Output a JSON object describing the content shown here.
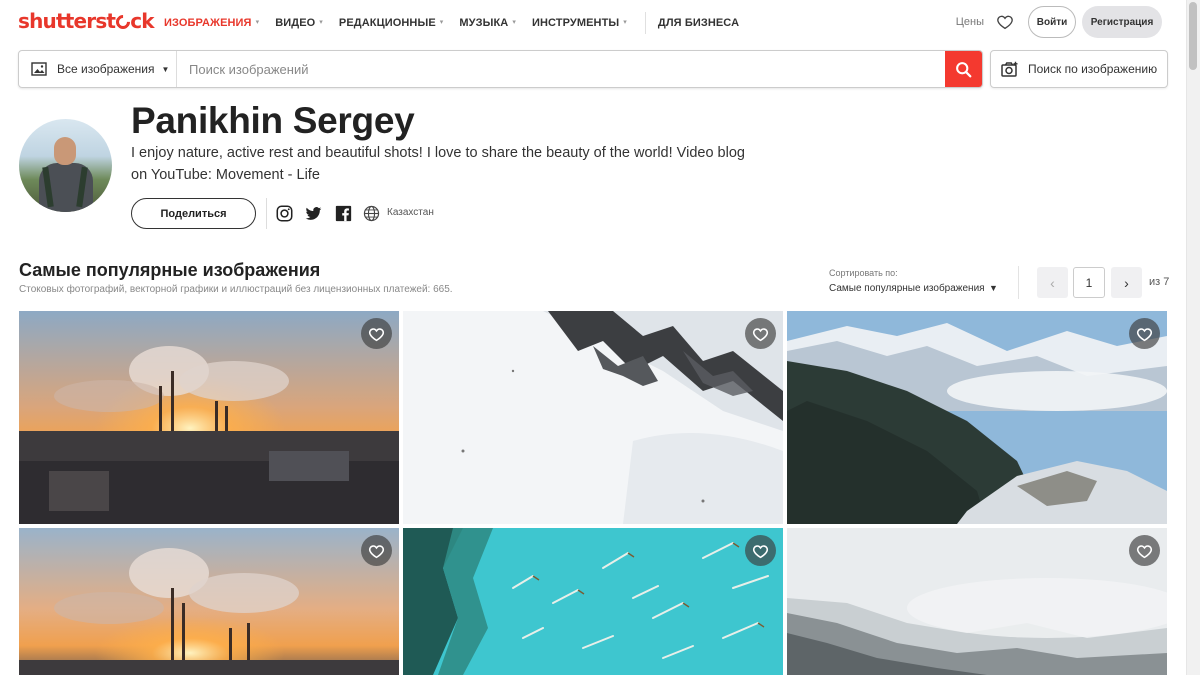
{
  "logo": {
    "part1": "shutterst",
    "part2": "ck"
  },
  "nav": {
    "items": [
      {
        "label": "ИЗОБРАЖЕНИЯ",
        "active": true,
        "dropdown": true
      },
      {
        "label": "ВИДЕО",
        "active": false,
        "dropdown": true
      },
      {
        "label": "РЕДАКЦИОННЫЕ",
        "active": false,
        "dropdown": true
      },
      {
        "label": "МУЗЫКА",
        "active": false,
        "dropdown": true
      },
      {
        "label": "ИНСТРУМЕНТЫ",
        "active": false,
        "dropdown": true
      },
      {
        "label": "ДЛЯ БИЗНЕСА",
        "active": false,
        "dropdown": false
      }
    ],
    "prices": "Цены",
    "login": "Войти",
    "register": "Регистрация"
  },
  "search": {
    "type": "Все изображения",
    "placeholder": "Поиск изображений",
    "image_search": "Поиск по изображению"
  },
  "profile": {
    "name": "Panikhin Sergey",
    "bio": "I enjoy nature, active rest and beautiful shots! I love to share the beauty of the world! Video blog on YouTube: Movement - Life",
    "share": "Поделиться",
    "location": "Казахстан"
  },
  "section": {
    "title": "Самые популярные изображения",
    "subtitle": "Стоковых фотографий, векторной графики и иллюстраций без лицензионных платежей: 665.",
    "sort_label": "Сортировать по:",
    "sort_value": "Самые популярные изображения",
    "page": "1",
    "total": "из 7"
  },
  "colors": {
    "brand": "#e8372b",
    "search_button": "#f4392f"
  },
  "tiles": [
    {
      "name": "tile-factory-sunset-1",
      "favorite_icon": "heart-outline-icon"
    },
    {
      "name": "tile-snowy-slope-aerial",
      "favorite_icon": "heart-outline-icon"
    },
    {
      "name": "tile-mountain-forest-clouds",
      "favorite_icon": "heart-outline-icon"
    },
    {
      "name": "tile-factory-sunset-2",
      "favorite_icon": "heart-outline-icon"
    },
    {
      "name": "tile-turquoise-lake-trees",
      "favorite_icon": "heart-outline-icon"
    },
    {
      "name": "tile-foggy-forest-snow",
      "favorite_icon": "heart-outline-icon"
    }
  ]
}
